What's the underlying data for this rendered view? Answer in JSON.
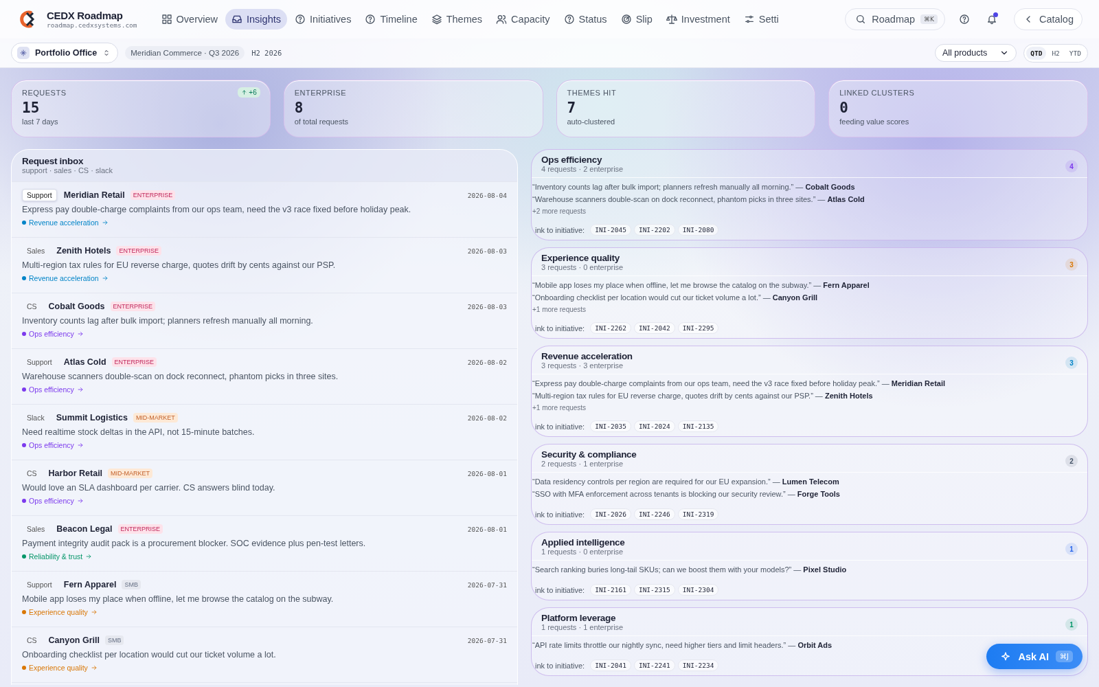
{
  "app": {
    "title": "CEDX Roadmap",
    "domain": "roadmap.cedxsystems.com"
  },
  "nav": [
    {
      "label": "Overview",
      "selected": false
    },
    {
      "label": "Insights",
      "selected": true
    },
    {
      "label": "Initiatives",
      "selected": false
    },
    {
      "label": "Timeline",
      "selected": false
    },
    {
      "label": "Themes",
      "selected": false
    },
    {
      "label": "Capacity",
      "selected": false
    },
    {
      "label": "Status",
      "selected": false
    },
    {
      "label": "Slip",
      "selected": false
    },
    {
      "label": "Investment",
      "selected": false
    },
    {
      "label": "Setti",
      "selected": false
    }
  ],
  "search": {
    "label": "Roadmap",
    "shortcut": "⌘K"
  },
  "notifications": {
    "unread": true
  },
  "catalog_button": "Catalog",
  "context": {
    "workspace": "Portfolio Office",
    "scope": "Meridian Commerce · Q3 2026",
    "period": "H2 2026"
  },
  "product_filter": "All products",
  "ranges": [
    {
      "label": "QTD",
      "selected": true
    },
    {
      "label": "H2",
      "selected": false
    },
    {
      "label": "YTD",
      "selected": false
    }
  ],
  "kpis": [
    {
      "label": "REQUESTS",
      "value": "15",
      "note": "last 7 days",
      "delta": "+6"
    },
    {
      "label": "ENTERPRISE",
      "value": "8",
      "note": "of total requests"
    },
    {
      "label": "THEMES HIT",
      "value": "7",
      "note": "auto-clustered"
    },
    {
      "label": "LINKED CLUSTERS",
      "value": "0",
      "note": "feeding value scores"
    }
  ],
  "inbox": {
    "title": "Request inbox",
    "subtitle": "support · sales · CS · slack",
    "requests": [
      {
        "source": "Support",
        "selected": true,
        "customer": "Meridian Retail",
        "segment": "ENTERPRISE",
        "kind": "enterprise",
        "date": "2026-08-04",
        "text": "Express pay double-charge complaints from our ops team, need the v3 race fixed before holiday peak.",
        "theme": "Revenue acceleration",
        "color": "#0284c7"
      },
      {
        "source": "Sales",
        "selected": false,
        "customer": "Zenith Hotels",
        "segment": "ENTERPRISE",
        "kind": "enterprise",
        "date": "2026-08-03",
        "text": "Multi-region tax rules for EU reverse charge, quotes drift by cents against our PSP.",
        "theme": "Revenue acceleration",
        "color": "#0284c7"
      },
      {
        "source": "CS",
        "selected": false,
        "customer": "Cobalt Goods",
        "segment": "ENTERPRISE",
        "kind": "enterprise",
        "date": "2026-08-03",
        "text": "Inventory counts lag after bulk import; planners refresh manually all morning.",
        "theme": "Ops efficiency",
        "color": "#7c3aed"
      },
      {
        "source": "Support",
        "selected": false,
        "customer": "Atlas Cold",
        "segment": "ENTERPRISE",
        "kind": "enterprise",
        "date": "2026-08-02",
        "text": "Warehouse scanners double-scan on dock reconnect, phantom picks in three sites.",
        "theme": "Ops efficiency",
        "color": "#7c3aed"
      },
      {
        "source": "Slack",
        "selected": false,
        "customer": "Summit Logistics",
        "segment": "MID-MARKET",
        "kind": "mid",
        "date": "2026-08-02",
        "text": "Need realtime stock deltas in the API, not 15-minute batches.",
        "theme": "Ops efficiency",
        "color": "#7c3aed"
      },
      {
        "source": "CS",
        "selected": false,
        "customer": "Harbor Retail",
        "segment": "MID-MARKET",
        "kind": "mid",
        "date": "2026-08-01",
        "text": "Would love an SLA dashboard per carrier. CS answers blind today.",
        "theme": "Ops efficiency",
        "color": "#7c3aed"
      },
      {
        "source": "Sales",
        "selected": false,
        "customer": "Beacon Legal",
        "segment": "ENTERPRISE",
        "kind": "enterprise",
        "date": "2026-08-01",
        "text": "Payment integrity audit pack is a procurement blocker. SOC evidence plus pen-test letters.",
        "theme": "Reliability & trust",
        "color": "#059669"
      },
      {
        "source": "Support",
        "selected": false,
        "customer": "Fern Apparel",
        "segment": "SMB",
        "kind": "smb",
        "date": "2026-07-31",
        "text": "Mobile app loses my place when offline, let me browse the catalog on the subway.",
        "theme": "Experience quality",
        "color": "#d97706"
      },
      {
        "source": "CS",
        "selected": false,
        "customer": "Canyon Grill",
        "segment": "SMB",
        "kind": "smb",
        "date": "2026-07-31",
        "text": "Onboarding checklist per location would cut our ticket volume a lot.",
        "theme": "Experience quality",
        "color": "#d97706"
      }
    ]
  },
  "themes": [
    {
      "name": "Ops efficiency",
      "summary": "4 requests · 2 enterprise",
      "count": "4",
      "color": "#7c3aed",
      "quotes": [
        "“Inventory counts lag after bulk import; planners refresh manually all morning.” — **Cobalt Goods**",
        "“Warehouse scanners double-scan on dock reconnect, phantom picks in three sites.” — **Atlas Cold**"
      ],
      "more": "+2 more requests",
      "link_label": "ink to initiative:",
      "initiatives": [
        "INI-2045",
        "INI-2202",
        "INI-2080"
      ]
    },
    {
      "name": "Experience quality",
      "summary": "3 requests · 0 enterprise",
      "count": "3",
      "color": "#d97706",
      "quotes": [
        "“Mobile app loses my place when offline, let me browse the catalog on the subway.” — **Fern Apparel**",
        "“Onboarding checklist per location would cut our ticket volume a lot.” — **Canyon Grill**"
      ],
      "more": "+1 more requests",
      "link_label": "ink to initiative:",
      "initiatives": [
        "INI-2262",
        "INI-2042",
        "INI-2295"
      ]
    },
    {
      "name": "Revenue acceleration",
      "summary": "3 requests · 3 enterprise",
      "count": "3",
      "color": "#0284c7",
      "quotes": [
        "“Express pay double-charge complaints from our ops team, need the v3 race fixed before holiday peak.” — **Meridian Retail**",
        "“Multi-region tax rules for EU reverse charge, quotes drift by cents against our PSP.” — **Zenith Hotels**"
      ],
      "more": "+1 more requests",
      "link_label": "ink to initiative:",
      "initiatives": [
        "INI-2035",
        "INI-2024",
        "INI-2135"
      ]
    },
    {
      "name": "Security & compliance",
      "summary": "2 requests · 1 enterprise",
      "count": "2",
      "color": "#475569",
      "quotes": [
        "“Data residency controls per region are required for our EU expansion.” — **Lumen Telecom**",
        "“SSO with MFA enforcement across tenants is blocking our security review.” — **Forge Tools**"
      ],
      "link_label": "ink to initiative:",
      "initiatives": [
        "INI-2026",
        "INI-2246",
        "INI-2319"
      ]
    },
    {
      "name": "Applied intelligence",
      "summary": "1 requests · 0 enterprise",
      "count": "1",
      "color": "#2563eb",
      "quotes": [
        "“Search ranking buries long-tail SKUs; can we boost them with your models?” — **Pixel Studio**"
      ],
      "link_label": "ink to initiative:",
      "initiatives": [
        "INI-2161",
        "INI-2315",
        "INI-2304"
      ]
    },
    {
      "name": "Platform leverage",
      "summary": "1 requests · 1 enterprise",
      "count": "1",
      "color": "#059669",
      "quotes": [
        "“API rate limits throttle our nightly sync, need higher tiers and limit headers.” — **Orbit Ads**"
      ],
      "link_label": "ink to initiative:",
      "initiatives": [
        "INI-2041",
        "INI-2241",
        "INI-2234"
      ]
    }
  ],
  "ask_ai": {
    "label": "Ask AI",
    "shortcut": "⌘J"
  }
}
